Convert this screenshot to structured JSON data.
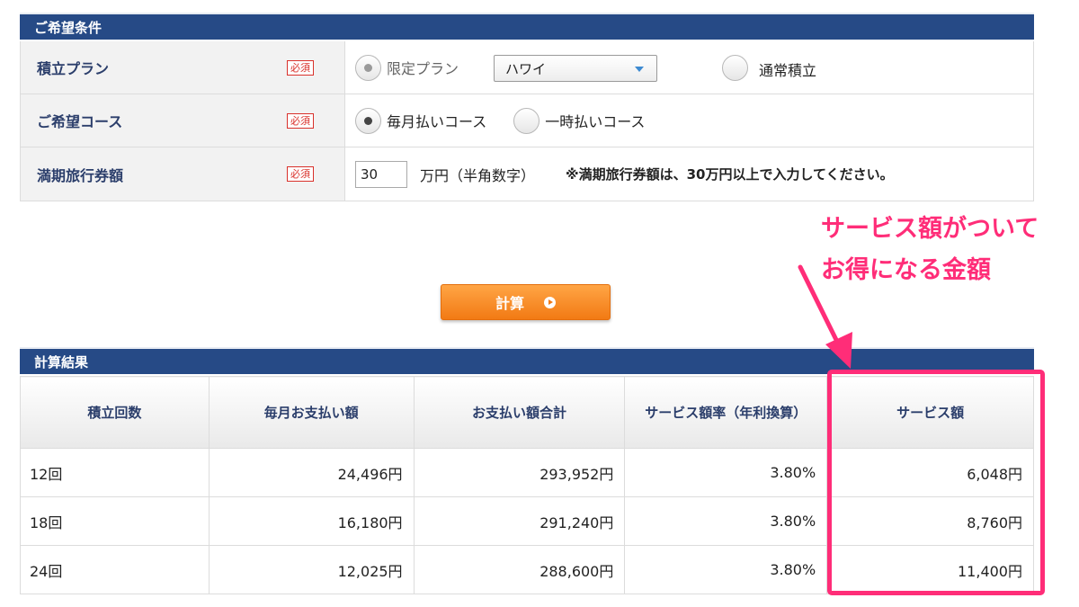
{
  "conditions": {
    "header": "ご希望条件",
    "required_badge": "必須",
    "plan": {
      "label": "積立プラン",
      "option_limited": "限定プラン",
      "select_value": "ハワイ",
      "option_normal": "通常積立"
    },
    "course": {
      "label": "ご希望コース",
      "option_monthly": "毎月払いコース",
      "option_lump": "一時払いコース"
    },
    "amount": {
      "label": "満期旅行券額",
      "value": "30",
      "unit": "万円（半角数字）",
      "note": "※満期旅行券額は、30万円以上で入力してください。"
    }
  },
  "calculate_button": {
    "label": "計算"
  },
  "results": {
    "header": "計算結果",
    "columns": [
      "積立回数",
      "毎月お支払い額",
      "お支払い額合計",
      "サービス額率（年利換算）",
      "サービス額"
    ],
    "rows": [
      [
        "12回",
        "24,496円",
        "293,952円",
        "3.80%",
        "6,048円"
      ],
      [
        "18回",
        "16,180円",
        "291,240円",
        "3.80%",
        "8,760円"
      ],
      [
        "24回",
        "12,025円",
        "288,600円",
        "3.80%",
        "11,400円"
      ]
    ]
  },
  "annotation": {
    "line1": "サービス額がついて",
    "line2": "お得になる金額",
    "color": "#ff2d78"
  },
  "colors": {
    "header_bg": "#264a86",
    "button": "#f58a22",
    "label_text": "#2b3e6b"
  }
}
